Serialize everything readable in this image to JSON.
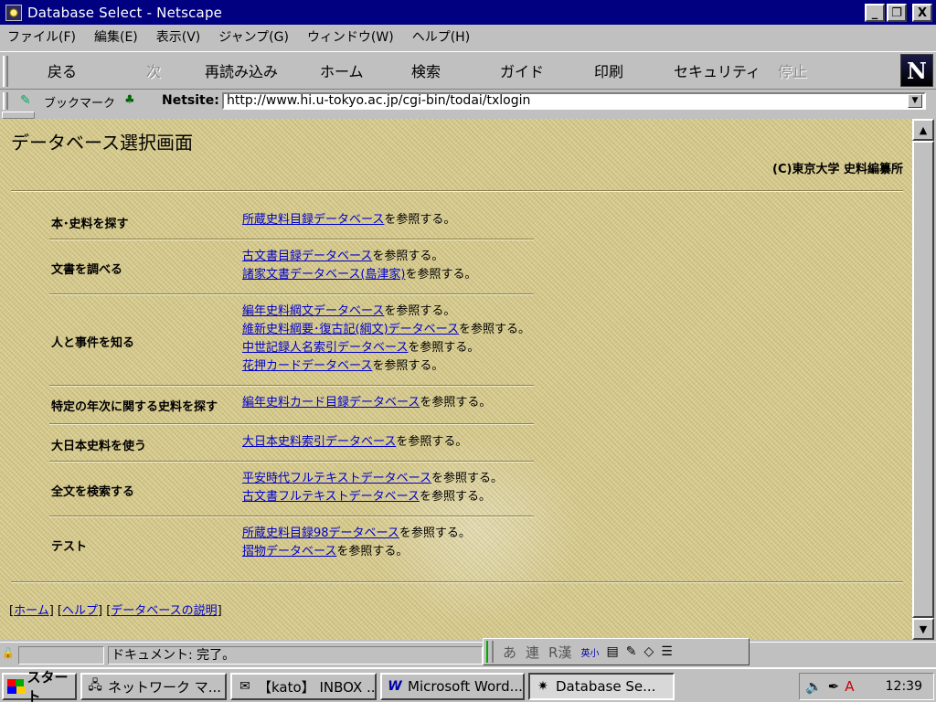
{
  "window": {
    "title": "Database Select - Netscape",
    "controls": {
      "minimize": "_",
      "restore": "❐",
      "close": "X"
    }
  },
  "menu": [
    "ファイル(F)",
    "編集(E)",
    "表示(V)",
    "ジャンプ(G)",
    "ウィンドウ(W)",
    "ヘルプ(H)"
  ],
  "toolbar": {
    "back": "戻る",
    "forward": "次",
    "reload": "再読み込み",
    "home": "ホーム",
    "search": "検索",
    "guide": "ガイド",
    "print": "印刷",
    "security": "セキュリティ",
    "stop": "停止",
    "logo": "N"
  },
  "location": {
    "bookmarks_label": "ブックマーク",
    "netsite_label": "Netsite:",
    "url": "http://www.hi.u-tokyo.ac.jp/cgi-bin/todai/txlogin"
  },
  "page": {
    "title": "データベース選択画面",
    "copyright": "(C)東京大学 史料編纂所",
    "suffix": "を参照する。",
    "categories": [
      {
        "label": "本･史料を探す",
        "links": [
          "所蔵史料目録データベース"
        ]
      },
      {
        "label": "文書を調べる",
        "links": [
          "古文書目録データベース",
          "諸家文書データベース(島津家)"
        ]
      },
      {
        "label": "人と事件を知る",
        "links": [
          "編年史料綱文データベース",
          "維新史料綱要･復古記(綱文)データベース",
          "中世記録人名索引データベース",
          "花押カードデータベース"
        ]
      },
      {
        "label": "特定の年次に関する史料を探す",
        "links": [
          "編年史料カード目録データベース"
        ]
      },
      {
        "label": "大日本史料を使う",
        "links": [
          "大日本史料索引データベース"
        ]
      },
      {
        "label": "全文を検索する",
        "links": [
          "平安時代フルテキストデータベース",
          "古文書フルテキストデータベース"
        ]
      },
      {
        "label": "テスト",
        "links": [
          "所蔵史料目録98データベース",
          "摺物データベース"
        ]
      }
    ],
    "footer": {
      "home": "ホーム",
      "help": "ヘルプ",
      "about": "データベースの説明"
    }
  },
  "status": {
    "text": "ドキュメント: 完了。"
  },
  "ime": {
    "a": "あ",
    "ren": "連",
    "rkan": "R漢",
    "eisho": "英小"
  },
  "taskbar": {
    "start": "スタート",
    "tasks": [
      "ネットワーク マ...",
      "【kato】 INBOX ...",
      "Microsoft Word...",
      "Database Se..."
    ],
    "clock": "12:39"
  }
}
